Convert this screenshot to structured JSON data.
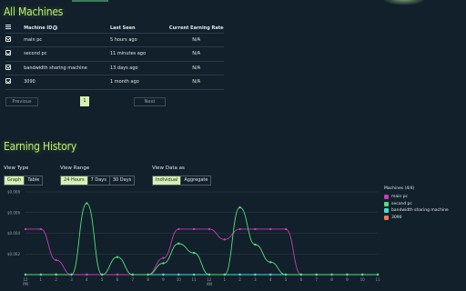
{
  "header": {
    "machines_title": "All Machines"
  },
  "table": {
    "headers": {
      "machine_id": "Machine ID",
      "last_seen": "Last Seen",
      "rate": "Current Earning Rate"
    },
    "rows": [
      {
        "id": "main pc",
        "last_seen": "5 hours ago",
        "rate": "N/A"
      },
      {
        "id": "second pc",
        "last_seen": "11 minutes ago",
        "rate": "N/A"
      },
      {
        "id": "bandwidth sharing machine",
        "last_seen": "13 days ago",
        "rate": "N/A"
      },
      {
        "id": "3090",
        "last_seen": "1 month ago",
        "rate": "N/A"
      }
    ]
  },
  "pagination": {
    "previous": "Previous",
    "page": "1",
    "next": "Next"
  },
  "earning": {
    "title": "Earning History",
    "view_type_label": "View Type",
    "view_type_options": [
      "Graph",
      "Table"
    ],
    "view_type_selected": "Graph",
    "view_range_label": "View Range",
    "view_range_options": [
      "24 Hours",
      "7 Days",
      "30 Days"
    ],
    "view_range_selected": "24 Hours",
    "view_data_label": "View Data as",
    "view_data_options": [
      "Individual",
      "Aggregate"
    ],
    "view_data_selected": "Individual"
  },
  "legend": {
    "heading": "Machines (4/4)",
    "items": [
      {
        "name": "main pc",
        "color": "#c83cb4"
      },
      {
        "name": "second pc",
        "color": "#50e07a"
      },
      {
        "name": "bandwidth sharing machine",
        "color": "#40e0d0"
      },
      {
        "name": "3090",
        "color": "#f07850"
      }
    ]
  },
  "chart_data": {
    "type": "line",
    "x": [
      "12 PM",
      "1",
      "2",
      "3",
      "4",
      "5",
      "6",
      "7",
      "8",
      "9",
      "10",
      "11",
      "12 AM",
      "1",
      "2",
      "3",
      "4",
      "5",
      "6",
      "7",
      "8",
      "9",
      "10",
      "11"
    ],
    "x_tick_labels": [
      "12\nPM",
      "1",
      "2",
      "3",
      "4",
      "5",
      "6",
      "7",
      "8",
      "9",
      "10",
      "11",
      "12\nAM",
      "1",
      "2",
      "3",
      "4",
      "5",
      "6",
      "7",
      "8",
      "9",
      "10",
      "11"
    ],
    "y_ticks": [
      "$0.002",
      "$0.004",
      "$0.006",
      "$0.008"
    ],
    "ylim": [
      0,
      0.008
    ],
    "series": [
      {
        "name": "main pc",
        "color": "#c83cb4",
        "values": [
          0.0044,
          0.0044,
          0.0014,
          0,
          0,
          0,
          0,
          0,
          0,
          0.0016,
          0.0044,
          0.0044,
          0.0044,
          0.0034,
          0.0044,
          0.0044,
          0.0044,
          0.0044,
          0,
          0,
          0,
          0,
          0,
          0
        ]
      },
      {
        "name": "second pc",
        "color": "#50e07a",
        "values": [
          0,
          0,
          0,
          0,
          0.0069,
          0,
          0.0017,
          0,
          0,
          0.0011,
          0.003,
          0.0021,
          0,
          0,
          0.0065,
          0.0029,
          0.0012,
          0,
          0,
          0,
          0,
          0,
          0,
          0
        ]
      },
      {
        "name": "bandwidth sharing machine",
        "color": "#40e0d0",
        "values": [
          0,
          0,
          0,
          0,
          0,
          0,
          0,
          0,
          0,
          0,
          0,
          0,
          0,
          0,
          0,
          0,
          0,
          0,
          0,
          0,
          0,
          0,
          0,
          0
        ]
      },
      {
        "name": "3090",
        "color": "#f07850",
        "values": [
          0,
          0,
          0,
          0,
          0,
          0,
          0,
          0,
          0,
          0,
          0,
          0,
          0,
          0,
          0,
          0,
          0,
          0,
          0,
          0,
          0,
          0,
          0,
          0
        ]
      }
    ],
    "grid": true,
    "legend_position": "right"
  }
}
